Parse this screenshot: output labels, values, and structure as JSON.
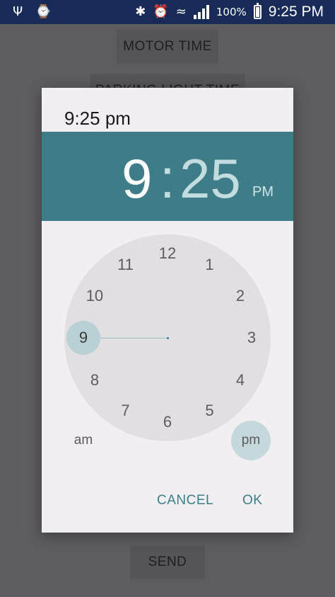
{
  "status_bar": {
    "left_icons": [
      "usb-icon",
      "watch-icon"
    ],
    "right_icons": [
      "bluetooth-icon",
      "alarm-icon",
      "wifi-icon",
      "signal-icon"
    ],
    "battery_percent": "100%",
    "battery_level": 1.0,
    "clock": "9:25 PM",
    "color": "#172a58"
  },
  "background": {
    "motor_time_label": "MOTOR TIME",
    "parking_light_time_label": "PARKING LIGHT TIME",
    "send_label": "SEND"
  },
  "dialog": {
    "title": "9:25 pm",
    "header": {
      "hour": "9",
      "separator": ":",
      "minute": "25",
      "ampm": "PM",
      "color": "#3e7d88"
    },
    "clock": {
      "numbers": [
        "12",
        "1",
        "2",
        "3",
        "4",
        "5",
        "6",
        "7",
        "8",
        "9",
        "10",
        "11"
      ],
      "selected": "9"
    },
    "am_label": "am",
    "pm_label": "pm",
    "selected_period": "pm",
    "cancel_label": "CANCEL",
    "ok_label": "OK"
  }
}
